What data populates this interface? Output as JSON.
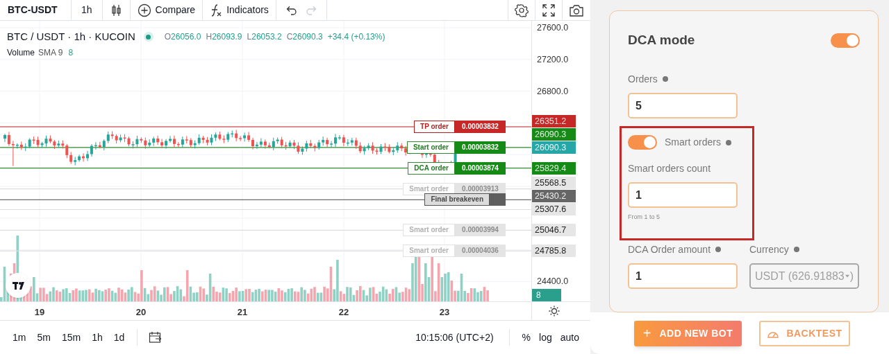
{
  "toolbar": {
    "symbol": "BTC-USDT",
    "interval": "1h",
    "items": [
      {
        "kind": "compare",
        "label": "Compare"
      },
      {
        "kind": "indicators",
        "label": "Indicators"
      }
    ],
    "undo": {
      "disabled": false
    },
    "redo": {
      "disabled": true
    }
  },
  "legend": {
    "title": "BTC / USDT · 1h · KUCOIN",
    "ohlc": [
      {
        "key": "O",
        "value": "26056.0"
      },
      {
        "key": "H",
        "value": "26093.9"
      },
      {
        "key": "L",
        "value": "26053.2"
      },
      {
        "key": "C",
        "value": "26090.3"
      }
    ],
    "change": "+34.4 (+0.13%)",
    "volume": {
      "label": "Volume",
      "study": "SMA 9",
      "value": "8"
    }
  },
  "price_axis": {
    "ticks": [
      "27600.0",
      "27200.0",
      "26800.0",
      "24400.0"
    ],
    "last_price": "26090.3",
    "volume_tag": "8"
  },
  "orders": [
    {
      "kind": "tp",
      "label": "TP order",
      "amount": "0.00003832",
      "price": "26351.2"
    },
    {
      "kind": "start",
      "label": "Start order",
      "amount": "0.00003832",
      "price": "26090.3"
    },
    {
      "kind": "dca",
      "label": "DCA order",
      "amount": "0.00003874",
      "price": "25829.4"
    },
    {
      "kind": "smart",
      "label": "Smart order",
      "amount": "0.00003913",
      "price": "25568.5"
    },
    {
      "kind": "breakeven",
      "label": "Final breakeven",
      "price": "25430.2"
    },
    {
      "kind": "smart",
      "price": "25307.6"
    },
    {
      "kind": "smart",
      "label": "Smart order",
      "amount": "0.00003994",
      "price": "25046.7"
    },
    {
      "kind": "smart",
      "label": "Smart order",
      "amount": "0.00004036",
      "price": "24785.8"
    }
  ],
  "time_axis": {
    "labels": [
      "19",
      "20",
      "21",
      "22",
      "23"
    ]
  },
  "bottom_bar": {
    "intervals": [
      "1m",
      "5m",
      "15m",
      "1h",
      "1d"
    ],
    "clock": "10:15:06 (UTC+2)",
    "options": [
      "%",
      "log",
      "auto"
    ]
  },
  "panel": {
    "title": "DCA mode",
    "dca_on": true,
    "orders": {
      "label": "Orders",
      "value": "5"
    },
    "smart": {
      "label": "Smart orders",
      "on": true,
      "count_label": "Smart orders count",
      "count_value": "1",
      "hint": "From 1 to 5"
    },
    "amount": {
      "label": "DCA Order amount",
      "value": "1"
    },
    "currency": {
      "label": "Currency",
      "value": "USDT (626.91883",
      "value_end": ")",
      "disabled": true
    }
  },
  "buttons": [
    {
      "kind": "primary",
      "icon": "+",
      "label": "ADD NEW BOT"
    },
    {
      "kind": "outline",
      "label": "BACKTEST"
    }
  ]
}
